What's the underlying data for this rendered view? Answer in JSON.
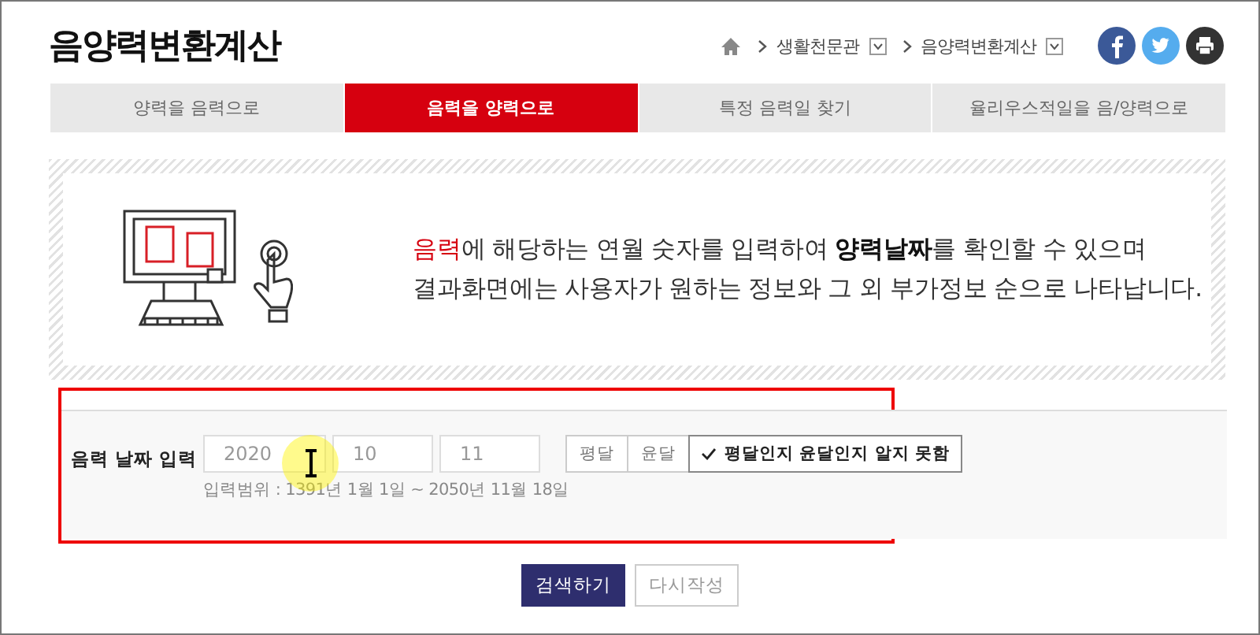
{
  "page_title": "음양력변환계산",
  "breadcrumb": [
    {
      "label": "생활천문관"
    },
    {
      "label": "음양력변환계산"
    }
  ],
  "share_icons": [
    {
      "kind": "facebook",
      "color": "#3b5998"
    },
    {
      "kind": "twitter",
      "color": "#55acee"
    },
    {
      "kind": "print",
      "color": "#333333"
    }
  ],
  "tabs": [
    {
      "label": "양력을 음력으로",
      "selected": false
    },
    {
      "label": "음력을 양력으로",
      "selected": true
    },
    {
      "label": "특정 음력일 찾기",
      "selected": false
    },
    {
      "label": "율리우스적일을 음/양력으로",
      "selected": false
    }
  ],
  "intro": {
    "lines": [
      [
        {
          "text": "음력",
          "kind": "accent"
        },
        {
          "text": "에 해당하는 연월 숫자를 입력하여 ",
          "kind": "plain"
        },
        {
          "text": "양력날짜",
          "kind": "bold"
        },
        {
          "text": "를 확인할 수 있으며",
          "kind": "plain"
        }
      ],
      [
        {
          "text": "결과화면에는 사용자가 원하는 정보와 그 외 부가정보 순으로 나타납니다.",
          "kind": "plain"
        }
      ]
    ]
  },
  "form": {
    "label": "음력 날짜 입력",
    "fields": [
      {
        "value": "2020"
      },
      {
        "value": "10"
      },
      {
        "value": "11"
      }
    ],
    "range_hint": "입력범위 : 1391년 1월 1일 ~ 2050년 11월 18일",
    "month_options": [
      {
        "label": "평달",
        "selected": false
      },
      {
        "label": "윤달",
        "selected": false
      },
      {
        "label": "평달인지 윤달인지 알지 못함",
        "selected": true
      }
    ]
  },
  "buttons": [
    {
      "label": "검색하기",
      "kind": "primary"
    },
    {
      "label": "다시작성",
      "kind": "secondary"
    }
  ]
}
